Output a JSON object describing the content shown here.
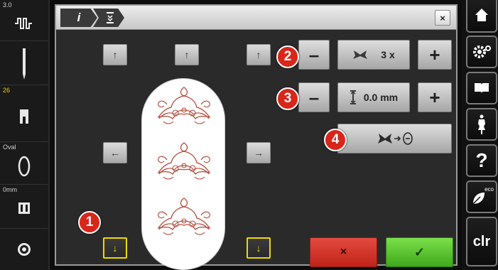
{
  "left_panel": {
    "stitch_width": "3.0",
    "needle_label": "",
    "presser_foot_number": "26",
    "hoop_label": "Oval",
    "offset_label": "0mm"
  },
  "dialog": {
    "tab_info": "i",
    "close_symbol": "×"
  },
  "controls": {
    "arrow_up": "↑",
    "arrow_down": "↓",
    "arrow_left": "←",
    "arrow_right": "→",
    "minus": "–",
    "plus": "+",
    "repeat_value": "3 x",
    "spacing_value": "0.0 mm",
    "cancel_symbol": "×",
    "confirm_symbol": "✓"
  },
  "badges": [
    "1",
    "2",
    "3",
    "4"
  ],
  "right_panel": {
    "clr_label": "clr",
    "help_label": "?",
    "eco_label": "eco"
  },
  "colors": {
    "highlight": "#f0d800",
    "badge": "#d8261a",
    "cancel": "#d83a2e",
    "confirm": "#58c82e",
    "embroidery": "#b24a3a"
  }
}
